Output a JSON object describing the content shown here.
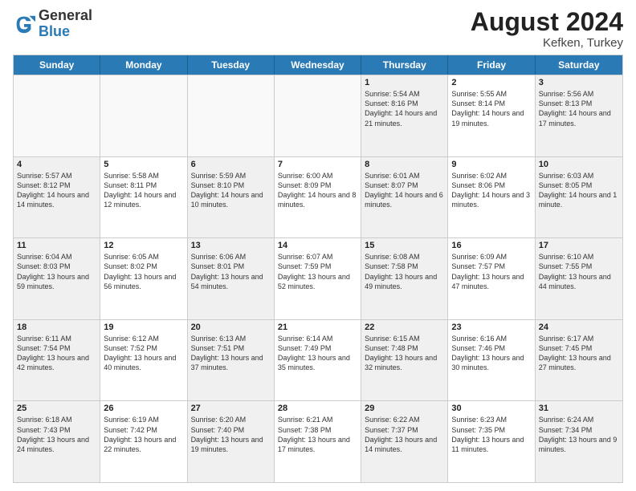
{
  "header": {
    "logo_general": "General",
    "logo_blue": "Blue",
    "month_year": "August 2024",
    "location": "Kefken, Turkey"
  },
  "days_of_week": [
    "Sunday",
    "Monday",
    "Tuesday",
    "Wednesday",
    "Thursday",
    "Friday",
    "Saturday"
  ],
  "weeks": [
    [
      {
        "day": "",
        "empty": true
      },
      {
        "day": "",
        "empty": true
      },
      {
        "day": "",
        "empty": true
      },
      {
        "day": "",
        "empty": true
      },
      {
        "day": "1",
        "sunrise": "5:54 AM",
        "sunset": "8:16 PM",
        "daylight": "14 hours and 21 minutes."
      },
      {
        "day": "2",
        "sunrise": "5:55 AM",
        "sunset": "8:14 PM",
        "daylight": "14 hours and 19 minutes."
      },
      {
        "day": "3",
        "sunrise": "5:56 AM",
        "sunset": "8:13 PM",
        "daylight": "14 hours and 17 minutes."
      }
    ],
    [
      {
        "day": "4",
        "sunrise": "5:57 AM",
        "sunset": "8:12 PM",
        "daylight": "14 hours and 14 minutes."
      },
      {
        "day": "5",
        "sunrise": "5:58 AM",
        "sunset": "8:11 PM",
        "daylight": "14 hours and 12 minutes."
      },
      {
        "day": "6",
        "sunrise": "5:59 AM",
        "sunset": "8:10 PM",
        "daylight": "14 hours and 10 minutes."
      },
      {
        "day": "7",
        "sunrise": "6:00 AM",
        "sunset": "8:09 PM",
        "daylight": "14 hours and 8 minutes."
      },
      {
        "day": "8",
        "sunrise": "6:01 AM",
        "sunset": "8:07 PM",
        "daylight": "14 hours and 6 minutes."
      },
      {
        "day": "9",
        "sunrise": "6:02 AM",
        "sunset": "8:06 PM",
        "daylight": "14 hours and 3 minutes."
      },
      {
        "day": "10",
        "sunrise": "6:03 AM",
        "sunset": "8:05 PM",
        "daylight": "14 hours and 1 minute."
      }
    ],
    [
      {
        "day": "11",
        "sunrise": "6:04 AM",
        "sunset": "8:03 PM",
        "daylight": "13 hours and 59 minutes."
      },
      {
        "day": "12",
        "sunrise": "6:05 AM",
        "sunset": "8:02 PM",
        "daylight": "13 hours and 56 minutes."
      },
      {
        "day": "13",
        "sunrise": "6:06 AM",
        "sunset": "8:01 PM",
        "daylight": "13 hours and 54 minutes."
      },
      {
        "day": "14",
        "sunrise": "6:07 AM",
        "sunset": "7:59 PM",
        "daylight": "13 hours and 52 minutes."
      },
      {
        "day": "15",
        "sunrise": "6:08 AM",
        "sunset": "7:58 PM",
        "daylight": "13 hours and 49 minutes."
      },
      {
        "day": "16",
        "sunrise": "6:09 AM",
        "sunset": "7:57 PM",
        "daylight": "13 hours and 47 minutes."
      },
      {
        "day": "17",
        "sunrise": "6:10 AM",
        "sunset": "7:55 PM",
        "daylight": "13 hours and 44 minutes."
      }
    ],
    [
      {
        "day": "18",
        "sunrise": "6:11 AM",
        "sunset": "7:54 PM",
        "daylight": "13 hours and 42 minutes."
      },
      {
        "day": "19",
        "sunrise": "6:12 AM",
        "sunset": "7:52 PM",
        "daylight": "13 hours and 40 minutes."
      },
      {
        "day": "20",
        "sunrise": "6:13 AM",
        "sunset": "7:51 PM",
        "daylight": "13 hours and 37 minutes."
      },
      {
        "day": "21",
        "sunrise": "6:14 AM",
        "sunset": "7:49 PM",
        "daylight": "13 hours and 35 minutes."
      },
      {
        "day": "22",
        "sunrise": "6:15 AM",
        "sunset": "7:48 PM",
        "daylight": "13 hours and 32 minutes."
      },
      {
        "day": "23",
        "sunrise": "6:16 AM",
        "sunset": "7:46 PM",
        "daylight": "13 hours and 30 minutes."
      },
      {
        "day": "24",
        "sunrise": "6:17 AM",
        "sunset": "7:45 PM",
        "daylight": "13 hours and 27 minutes."
      }
    ],
    [
      {
        "day": "25",
        "sunrise": "6:18 AM",
        "sunset": "7:43 PM",
        "daylight": "13 hours and 24 minutes."
      },
      {
        "day": "26",
        "sunrise": "6:19 AM",
        "sunset": "7:42 PM",
        "daylight": "13 hours and 22 minutes."
      },
      {
        "day": "27",
        "sunrise": "6:20 AM",
        "sunset": "7:40 PM",
        "daylight": "13 hours and 19 minutes."
      },
      {
        "day": "28",
        "sunrise": "6:21 AM",
        "sunset": "7:38 PM",
        "daylight": "13 hours and 17 minutes."
      },
      {
        "day": "29",
        "sunrise": "6:22 AM",
        "sunset": "7:37 PM",
        "daylight": "13 hours and 14 minutes."
      },
      {
        "day": "30",
        "sunrise": "6:23 AM",
        "sunset": "7:35 PM",
        "daylight": "13 hours and 11 minutes."
      },
      {
        "day": "31",
        "sunrise": "6:24 AM",
        "sunset": "7:34 PM",
        "daylight": "13 hours and 9 minutes."
      }
    ]
  ]
}
